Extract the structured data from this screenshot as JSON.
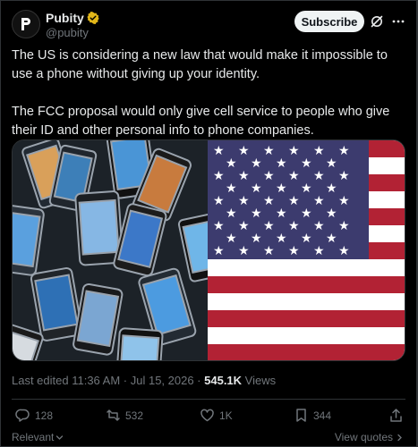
{
  "author": {
    "name": "Pubity",
    "handle": "@pubity"
  },
  "header": {
    "subscribe_label": "Subscribe"
  },
  "tweet": {
    "paragraphs": [
      "The US is considering a new law that would make it impossible to use a phone without giving up your identity.",
      "The FCC proposal would only give cell service to people who give their ID and other personal info to phone companies."
    ]
  },
  "meta": {
    "edited": "Last edited 11:36 AM · Jul 15, 2026 · ",
    "views_count": "545.1K",
    "views_label": " Views"
  },
  "actions": {
    "replies": "128",
    "reposts": "532",
    "likes": "1K",
    "bookmarks": "344"
  },
  "footer": {
    "sort_label": "Relevant",
    "quotes_label": "View quotes"
  },
  "colors": {
    "background": "#000000",
    "text": "#e7e9ea",
    "muted": "#71767b",
    "verified": "#e2b719",
    "flag_red": "#b22234",
    "flag_blue": "#3c3b6e"
  }
}
